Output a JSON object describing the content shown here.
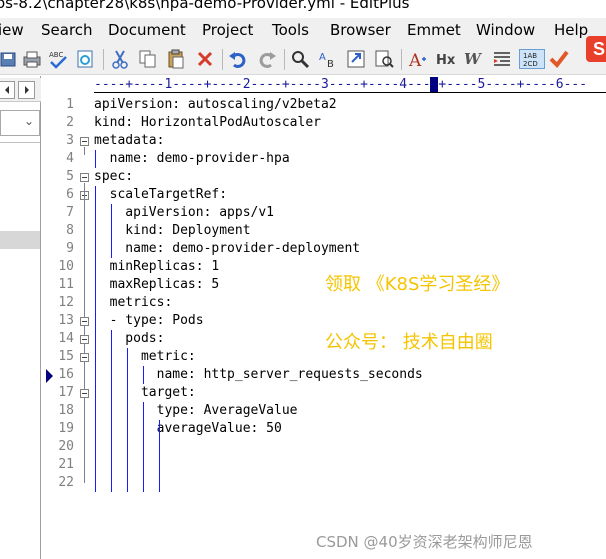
{
  "window": {
    "title": "os-8.2\\chapter28\\k8s\\hpa-demo-Provider.yml - EditPlus"
  },
  "menu": [
    {
      "label": "iew"
    },
    {
      "label": "Search"
    },
    {
      "label": "Document"
    },
    {
      "label": "Project"
    },
    {
      "label": "Tools"
    },
    {
      "label": "Browser"
    },
    {
      "label": "Emmet"
    },
    {
      "label": "Window"
    },
    {
      "label": "Help"
    }
  ],
  "toolbar": {
    "icons": [
      "save-all-icon",
      "print-icon",
      "spellcheck-icon",
      "preview-icon",
      "cut-icon",
      "copy-icon",
      "paste-icon",
      "delete-icon",
      "undo-icon",
      "redo-icon",
      "find-icon",
      "replace-icon",
      "goto-icon",
      "find-in-files-icon",
      "font-icon",
      "heading-icon",
      "word-wrap-icon",
      "indent-icon",
      "column-select-icon",
      "check-icon"
    ],
    "wrap_label": "1AB\n2CD"
  },
  "ruler": {
    "text": "----+----1----+----2----+----3----+----4----+----5----+----6---"
  },
  "editor": {
    "lines": [
      {
        "n": "1",
        "text": "apiVersion: autoscaling/v2beta2"
      },
      {
        "n": "2",
        "text": "kind: HorizontalPodAutoscaler"
      },
      {
        "n": "3",
        "text": "metadata:"
      },
      {
        "n": "4",
        "text": "  name: demo-provider-hpa"
      },
      {
        "n": "5",
        "text": "spec:"
      },
      {
        "n": "6",
        "text": "  scaleTargetRef:"
      },
      {
        "n": "7",
        "text": "    apiVersion: apps/v1"
      },
      {
        "n": "8",
        "text": "    kind: Deployment"
      },
      {
        "n": "9",
        "text": "    name: demo-provider-deployment"
      },
      {
        "n": "10",
        "text": "  minReplicas: 1"
      },
      {
        "n": "11",
        "text": "  maxReplicas: 5"
      },
      {
        "n": "12",
        "text": "  metrics:"
      },
      {
        "n": "13",
        "text": "  - type: Pods"
      },
      {
        "n": "14",
        "text": "    pods:"
      },
      {
        "n": "15",
        "text": "      metric:"
      },
      {
        "n": "16",
        "text": "        name: http_server_requests_seconds"
      },
      {
        "n": "17",
        "text": "      target:"
      },
      {
        "n": "18",
        "text": "        type: AverageValue"
      },
      {
        "n": "19",
        "text": "        averageValue: 50"
      },
      {
        "n": "20",
        "text": ""
      },
      {
        "n": "21",
        "text": ""
      },
      {
        "n": "22",
        "text": ""
      }
    ]
  },
  "overlay": {
    "line1": "领取 《K8S学习圣经》",
    "line2": "公众号： 技术自由圈"
  },
  "watermark": "CSDN @40岁资深老架构师尼恩",
  "logo": "S",
  "colors": {
    "overlay_text": "#f5c400",
    "ruler_cursor": "#000080",
    "indent_guide": "#1a1aff"
  }
}
